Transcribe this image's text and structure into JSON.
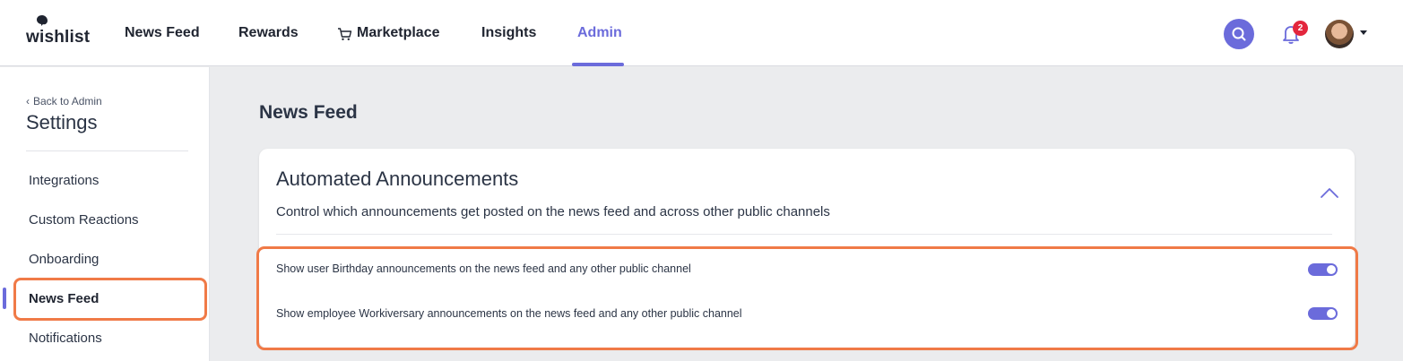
{
  "header": {
    "logo_text": "wishlist",
    "nav": [
      {
        "label": "News Feed"
      },
      {
        "label": "Rewards"
      },
      {
        "label": "Marketplace"
      },
      {
        "label": "Insights"
      },
      {
        "label": "Admin",
        "active": true
      }
    ],
    "notification_count": "2"
  },
  "sidebar": {
    "back_link": "Back to Admin",
    "title": "Settings",
    "items": [
      {
        "label": "Integrations"
      },
      {
        "label": "Custom Reactions"
      },
      {
        "label": "Onboarding"
      },
      {
        "label": "News Feed",
        "active": true
      },
      {
        "label": "Notifications"
      }
    ]
  },
  "main": {
    "page_title": "News Feed",
    "card": {
      "title": "Automated Announcements",
      "description": "Control which announcements get posted on the news feed and across other public channels",
      "settings": [
        {
          "label": "Show user Birthday announcements on the news feed and any other public channel",
          "enabled": true
        },
        {
          "label": "Show employee Workiversary announcements on the news feed and any other public channel",
          "enabled": true
        }
      ]
    }
  },
  "colors": {
    "accent": "#6b6bdb",
    "highlight": "#f07a47",
    "badge": "#e3263d"
  }
}
